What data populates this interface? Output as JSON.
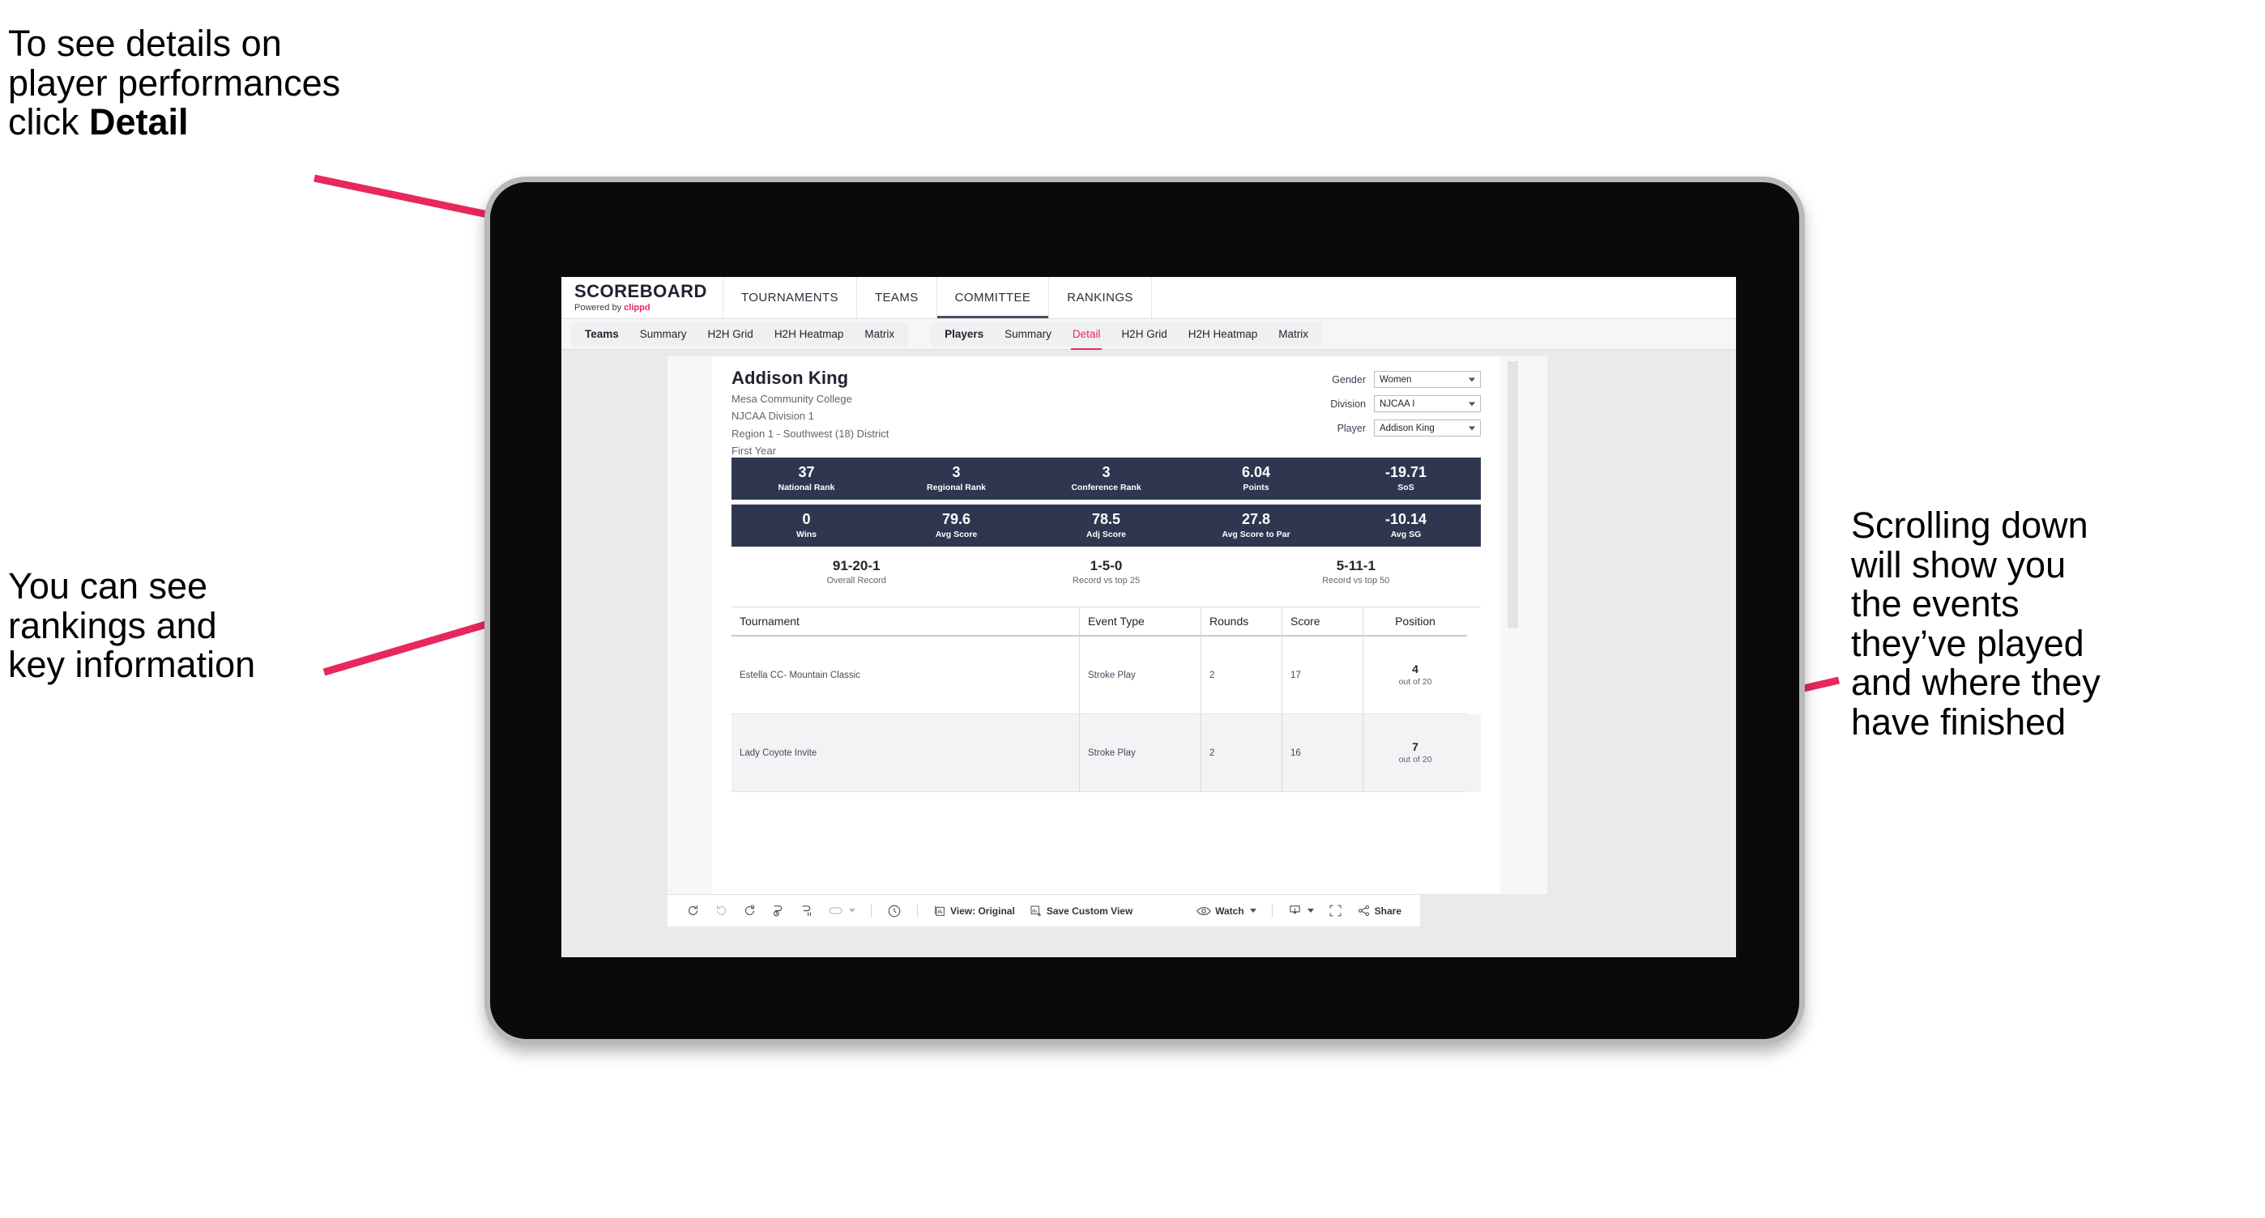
{
  "annotations": {
    "detail_note": "To see details on\nplayer performances\nclick ",
    "detail_note_bold": "Detail",
    "rankings_note": "You can see\nrankings and\nkey information",
    "scroll_note": "Scrolling down\nwill show you\nthe events\nthey’ve played\nand where they\nhave finished",
    "arrow_color": "#e8285c"
  },
  "app": {
    "brand": {
      "title": "SCOREBOARD",
      "powered_prefix": "Powered by ",
      "powered_name": "clippd"
    },
    "topnav": [
      {
        "label": "TOURNAMENTS",
        "active": false
      },
      {
        "label": "TEAMS",
        "active": false
      },
      {
        "label": "COMMITTEE",
        "active": true
      },
      {
        "label": "RANKINGS",
        "active": false
      }
    ],
    "subnav": {
      "teams_group": [
        {
          "label": "Teams",
          "active": false,
          "is_group_label": true
        },
        {
          "label": "Summary",
          "active": false
        },
        {
          "label": "H2H Grid",
          "active": false
        },
        {
          "label": "H2H Heatmap",
          "active": false
        },
        {
          "label": "Matrix",
          "active": false
        }
      ],
      "players_group": [
        {
          "label": "Players",
          "active": false,
          "is_group_label": true
        },
        {
          "label": "Summary",
          "active": false
        },
        {
          "label": "Detail",
          "active": true
        },
        {
          "label": "H2H Grid",
          "active": false
        },
        {
          "label": "H2H Heatmap",
          "active": false
        },
        {
          "label": "Matrix",
          "active": false
        }
      ]
    }
  },
  "player": {
    "name": "Addison King",
    "school": "Mesa Community College",
    "division": "NJCAA Division 1",
    "region": "Region 1 - Southwest (18) District",
    "year": "First Year"
  },
  "filters": [
    {
      "label": "Gender",
      "value": "Women"
    },
    {
      "label": "Division",
      "value": "NJCAA I"
    },
    {
      "label": "Player",
      "value": "Addison King"
    }
  ],
  "stat_bands": [
    [
      {
        "value": "37",
        "label": "National Rank"
      },
      {
        "value": "3",
        "label": "Regional Rank"
      },
      {
        "value": "3",
        "label": "Conference Rank"
      },
      {
        "value": "6.04",
        "label": "Points"
      },
      {
        "value": "-19.71",
        "label": "SoS"
      }
    ],
    [
      {
        "value": "0",
        "label": "Wins"
      },
      {
        "value": "79.6",
        "label": "Avg Score"
      },
      {
        "value": "78.5",
        "label": "Adj Score"
      },
      {
        "value": "27.8",
        "label": "Avg Score to Par"
      },
      {
        "value": "-10.14",
        "label": "Avg SG"
      }
    ]
  ],
  "records": [
    {
      "value": "91-20-1",
      "label": "Overall Record"
    },
    {
      "value": "1-5-0",
      "label": "Record vs top 25"
    },
    {
      "value": "5-11-1",
      "label": "Record vs top 50"
    }
  ],
  "table": {
    "columns": [
      "Tournament",
      "Event Type",
      "Rounds",
      "Score",
      "Position"
    ],
    "rows": [
      {
        "tournament": "Estella CC- Mountain Classic",
        "event_type": "Stroke Play",
        "rounds": "2",
        "score": "17",
        "position_num": "4",
        "position_sub": "out of 20"
      },
      {
        "tournament": "Lady Coyote Invite",
        "event_type": "Stroke Play",
        "rounds": "2",
        "score": "16",
        "position_num": "7",
        "position_sub": "out of 20"
      }
    ]
  },
  "toolbar": {
    "view_label": "View: Original",
    "save_label": "Save Custom View",
    "watch_label": "Watch",
    "share_label": "Share"
  }
}
